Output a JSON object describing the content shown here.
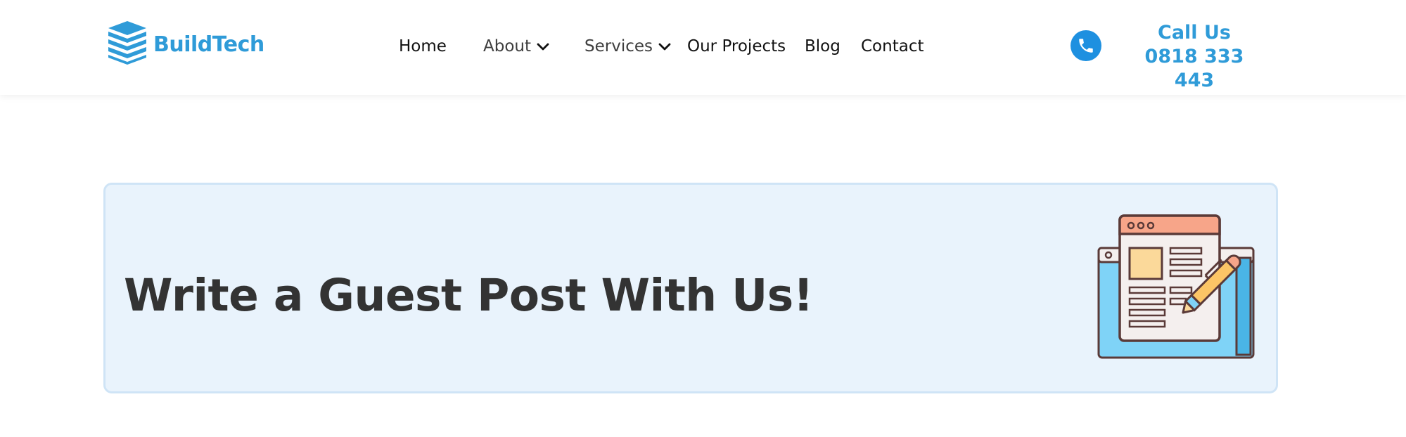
{
  "brand": {
    "name": "BuildTech",
    "logo_icon": "stacked-building-icon",
    "color": "#2f9bd8"
  },
  "nav": {
    "items": [
      {
        "label": "Home",
        "has_dropdown": false
      },
      {
        "label": "About",
        "has_dropdown": true
      },
      {
        "label": "Services",
        "has_dropdown": true
      },
      {
        "label": "Our Projects",
        "has_dropdown": false
      },
      {
        "label": "Blog",
        "has_dropdown": false
      },
      {
        "label": "Contact",
        "has_dropdown": false
      }
    ]
  },
  "contact": {
    "icon": "phone-icon",
    "label": "Call Us",
    "number": "0818 333 443",
    "icon_color": "#1e90e0"
  },
  "banner": {
    "title": "Write a Guest Post With Us!",
    "illustration": "browser-document-pencil-icon",
    "background": "#e9f3fc"
  }
}
